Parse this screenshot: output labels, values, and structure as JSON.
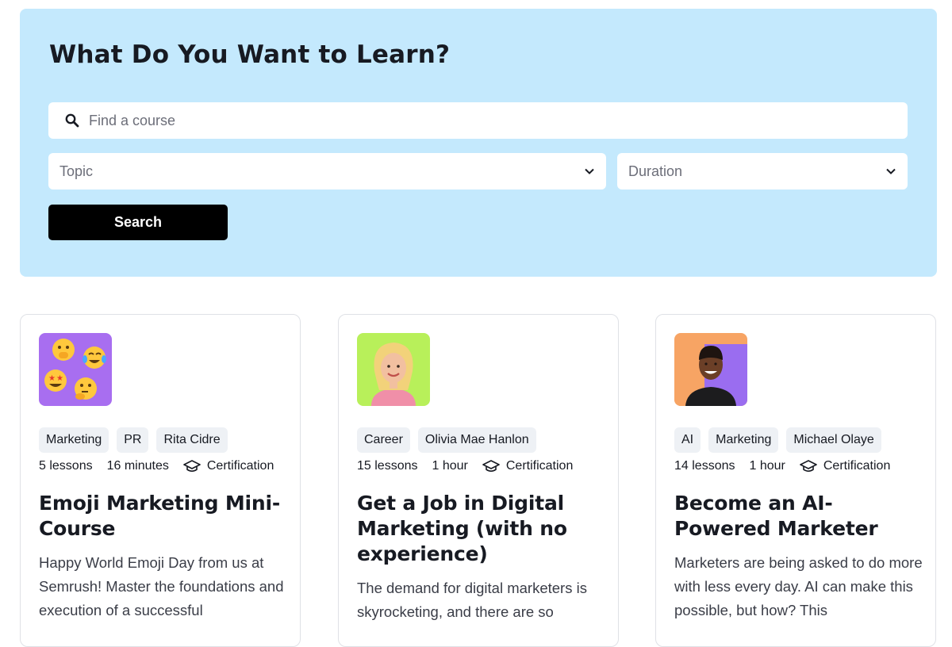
{
  "hero": {
    "title": "What Do You Want to Learn?",
    "search_placeholder": "Find a course",
    "topic_placeholder": "Topic",
    "duration_placeholder": "Duration",
    "search_button": "Search"
  },
  "colors": {
    "hero_bg": "#c4e9fd",
    "button_bg": "#000000",
    "tag_bg": "#eef1f5"
  },
  "courses": [
    {
      "thumb": "emoji-faces-image",
      "thumb_bg": "#a86ef0",
      "tags": [
        "Marketing",
        "PR",
        "Rita Cidre"
      ],
      "lessons": "5 lessons",
      "duration": "16 minutes",
      "certification": "Certification",
      "title": "Emoji Marketing Mini-Course",
      "description": "Happy World Emoji Day from us at Semrush! Master the foundations and execution of a successful"
    },
    {
      "thumb": "instructor-portrait-image",
      "thumb_bg": "#b8f05a",
      "tags": [
        "Career",
        "Olivia Mae Hanlon"
      ],
      "lessons": "15 lessons",
      "duration": "1 hour",
      "certification": "Certification",
      "title": "Get a Job in Digital Marketing (with no experience)",
      "description": "The demand for digital marketers is skyrocketing, and there are so"
    },
    {
      "thumb": "instructor-portrait-image",
      "thumb_bg": "#f7a464",
      "tags": [
        "AI",
        "Marketing",
        "Michael Olaye"
      ],
      "lessons": "14 lessons",
      "duration": "1 hour",
      "certification": "Certification",
      "title": "Become an AI-Powered Marketer",
      "description": "Marketers are being asked to do more with less every day. AI can make this possible, but how? This"
    }
  ]
}
